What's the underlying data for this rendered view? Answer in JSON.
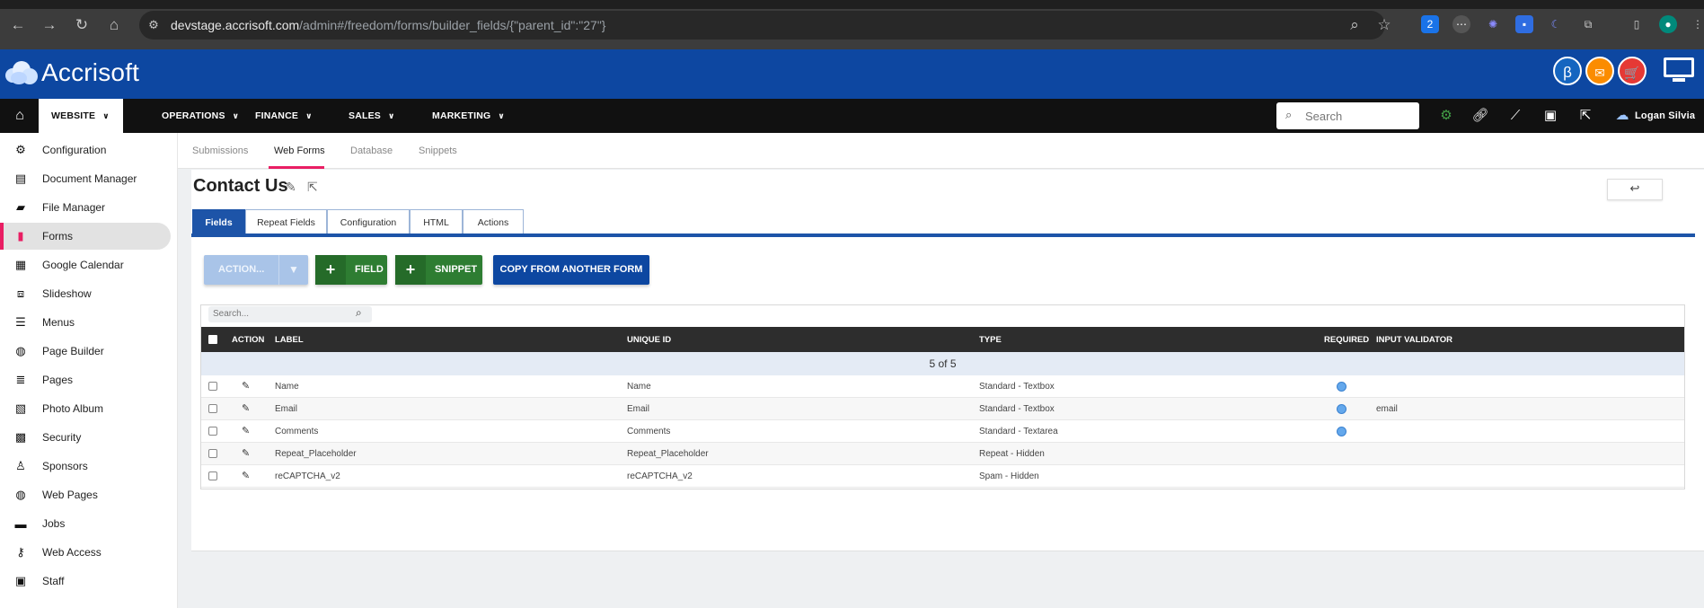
{
  "browser": {
    "url_host": "devstage.accrisoft.com",
    "url_path": "/admin#/freedom/forms/builder_fields/{\"parent_id\":\"27\"}"
  },
  "app": {
    "brand": "Accrisoft",
    "badges": [
      "β",
      "✉",
      "🛒"
    ]
  },
  "main_nav": {
    "items": [
      {
        "label": "WEBSITE"
      },
      {
        "label": "OPERATIONS"
      },
      {
        "label": "FINANCE"
      },
      {
        "label": "SALES"
      },
      {
        "label": "MARKETING"
      }
    ],
    "search_placeholder": "Search",
    "user_name": "Logan Silvia"
  },
  "sidebar": {
    "items": [
      {
        "label": "Configuration",
        "icon": "gears-icon"
      },
      {
        "label": "Document Manager",
        "icon": "document-icon"
      },
      {
        "label": "File Manager",
        "icon": "folder-icon"
      },
      {
        "label": "Forms",
        "icon": "clipboard-icon"
      },
      {
        "label": "Google Calendar",
        "icon": "calendar-icon"
      },
      {
        "label": "Slideshow",
        "icon": "slideshow-icon"
      },
      {
        "label": "Menus",
        "icon": "menu-icon"
      },
      {
        "label": "Page Builder",
        "icon": "globe-icon"
      },
      {
        "label": "Pages",
        "icon": "pages-icon"
      },
      {
        "label": "Photo Album",
        "icon": "photo-icon"
      },
      {
        "label": "Security",
        "icon": "grid-icon"
      },
      {
        "label": "Sponsors",
        "icon": "sponsor-icon"
      },
      {
        "label": "Web Pages",
        "icon": "globe-icon"
      },
      {
        "label": "Jobs",
        "icon": "briefcase-icon"
      },
      {
        "label": "Web Access",
        "icon": "key-icon"
      },
      {
        "label": "Staff",
        "icon": "id-card-icon"
      }
    ]
  },
  "subtabs": [
    "Submissions",
    "Web Forms",
    "Database",
    "Snippets"
  ],
  "page": {
    "title": "Contact Us",
    "back_glyph": "↩"
  },
  "tabs": [
    "Fields",
    "Repeat Fields",
    "Configuration",
    "HTML",
    "Actions"
  ],
  "toolbar": {
    "action_label": "ACTION...",
    "field_label": "FIELD",
    "snippet_label": "SNIPPET",
    "copy_label": "COPY FROM ANOTHER FORM"
  },
  "grid": {
    "search_placeholder": "Search...",
    "columns": [
      "ACTION",
      "LABEL",
      "UNIQUE ID",
      "TYPE",
      "REQUIRED",
      "INPUT VALIDATOR"
    ],
    "count_text": "5 of 5",
    "rows": [
      {
        "label": "Name",
        "unique_id": "Name",
        "type": "Standard - Textbox",
        "required": true,
        "validator": ""
      },
      {
        "label": "Email",
        "unique_id": "Email",
        "type": "Standard - Textbox",
        "required": true,
        "validator": "email"
      },
      {
        "label": "Comments",
        "unique_id": "Comments",
        "type": "Standard - Textarea",
        "required": true,
        "validator": ""
      },
      {
        "label": "Repeat_Placeholder",
        "unique_id": "Repeat_Placeholder",
        "type": "Repeat - Hidden",
        "required": false,
        "validator": ""
      },
      {
        "label": "reCAPTCHA_v2",
        "unique_id": "reCAPTCHA_v2",
        "type": "Spam - Hidden",
        "required": false,
        "validator": ""
      }
    ]
  },
  "colors": {
    "header_blue": "#0d47a1",
    "accent_pink": "#e91e63",
    "green": "#2e7d32"
  }
}
